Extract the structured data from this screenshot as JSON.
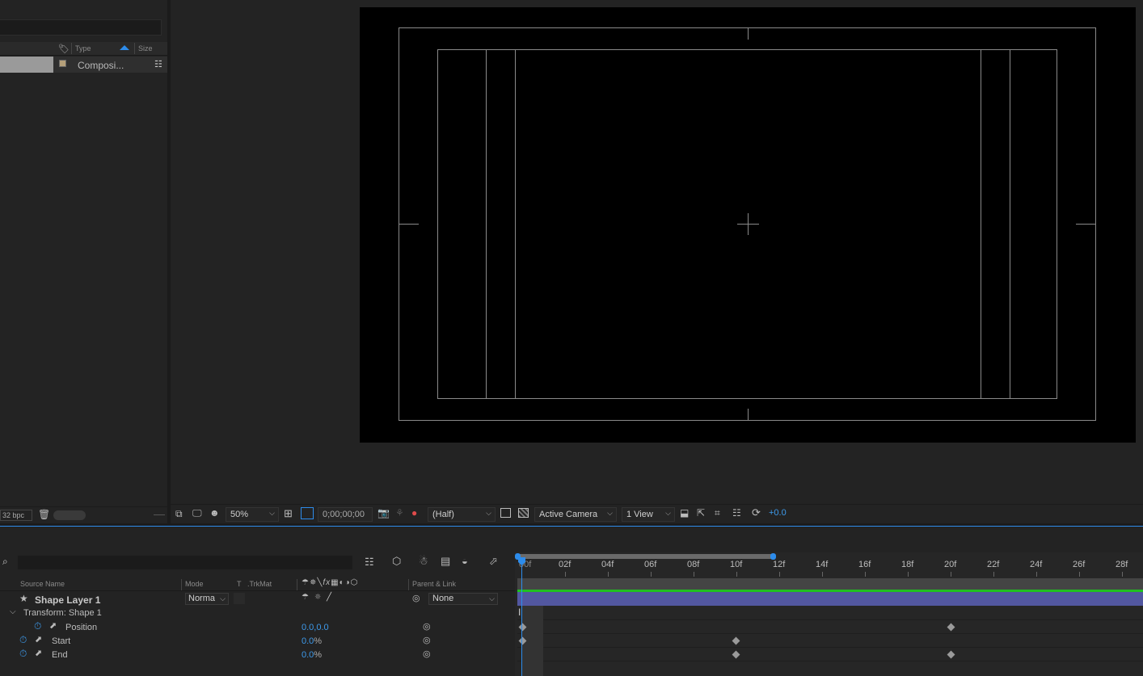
{
  "project": {
    "columns": {
      "type": "Type",
      "size": "Size"
    },
    "item": {
      "type": "Composi..."
    },
    "bpc": "32 bpc"
  },
  "viewer": {
    "zoom": "50%",
    "timecode": "0;00;00;00",
    "resolution": "(Half)",
    "camera": "Active Camera",
    "views": "1 View",
    "exposure": "+0.0"
  },
  "timeline": {
    "ruler": [
      "02f",
      "04f",
      "06f",
      "08f",
      "10f",
      "12f",
      "14f",
      "16f",
      "18f",
      "20f",
      "22f",
      "24f",
      "26f",
      "28f"
    ],
    "ruler_start": "00f",
    "columns": {
      "source_name": "Source Name",
      "mode": "Mode",
      "t": "T",
      "trkmat": ".TrkMat",
      "parent": "Parent & Link"
    },
    "layer": {
      "name": "Shape Layer 1",
      "mode": "Norma",
      "parent": "None"
    },
    "group": "Transform: Shape 1",
    "properties": [
      {
        "name": "Position",
        "value": "0.0,0.0",
        "unit": ""
      },
      {
        "name": "Start",
        "value": "0.0",
        "unit": "%"
      },
      {
        "name": "End",
        "value": "0.0",
        "unit": "%"
      }
    ]
  },
  "colors": {
    "accent": "#2d8ceb",
    "layer_bar": "#5257a0",
    "canvas": "#000000"
  }
}
